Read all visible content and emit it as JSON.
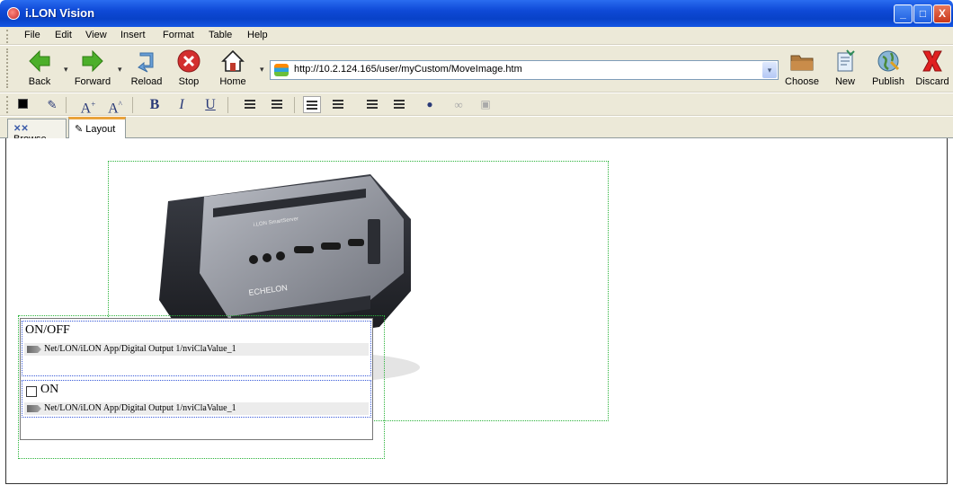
{
  "window": {
    "title": "i.LON Vision",
    "controls": {
      "minimize": "_",
      "maximize": "□",
      "close": "X"
    }
  },
  "menu": [
    "File",
    "Edit",
    "View",
    "Insert",
    "Format",
    "Table",
    "Help"
  ],
  "nav": {
    "back": "Back",
    "forward": "Forward",
    "reload": "Reload",
    "stop": "Stop",
    "home": "Home",
    "address": "http://10.2.124.165/user/myCustom/MoveImage.htm",
    "choose": "Choose",
    "new": "New",
    "publish": "Publish",
    "discard": "Discard"
  },
  "format": {
    "bold": "B",
    "italic": "I",
    "underline": "U",
    "font_up": "A",
    "font_down": "A"
  },
  "tabs": {
    "browse": "Browse",
    "layout": "Layout"
  },
  "canvas": {
    "widget1": {
      "label": "ON/OFF",
      "path": "Net/LON/iLON App/Digital Output 1/nviClaValue_1"
    },
    "widget2": {
      "label": "ON",
      "path": "Net/LON/iLON App/Digital Output 1/nviClaValue_1",
      "checked": false
    },
    "device_brand": "ECHELON",
    "device_model": "i.LON SmartServer"
  },
  "colors": {
    "titlebar": "#0842c8",
    "chrome": "#ece9d8",
    "guide": "#2bb33a",
    "inner_border": "#3a5bd9"
  }
}
